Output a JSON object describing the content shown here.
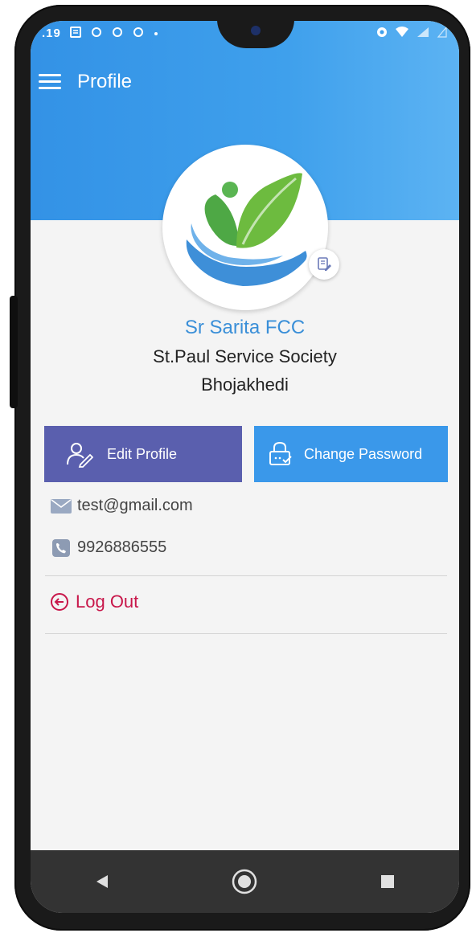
{
  "status_bar": {
    "time": ".19",
    "left_icons": [
      "notification-icon",
      "sync-icon",
      "sync-icon",
      "sync-icon",
      "dot-icon"
    ],
    "right_icons": [
      "alarm-icon",
      "wifi-icon",
      "signal-icon",
      "battery-icon"
    ]
  },
  "app_bar": {
    "title": "Profile",
    "menu_icon": "hamburger-menu-icon"
  },
  "profile": {
    "name": "Sr Sarita FCC",
    "organization": "St.Paul Service Society",
    "location": "Bhojakhedi",
    "avatar_icon": "leaf-hand-logo",
    "avatar_edit_icon": "edit-icon"
  },
  "actions": {
    "edit_profile_label": "Edit Profile",
    "change_password_label": "Change Password"
  },
  "contact": {
    "email": "test@gmail.com",
    "phone": "9926886555"
  },
  "logout": {
    "label": "Log Out"
  },
  "colors": {
    "header_blue": "#3392e6",
    "edit_button": "#5a5fae",
    "password_button": "#3a98ea",
    "name_color": "#3a8fd8",
    "logout_color": "#c8174a",
    "navbar": "#333333"
  },
  "nav_bar": {
    "back_icon": "back-triangle-icon",
    "home_icon": "home-circle-icon",
    "recents_icon": "recents-square-icon"
  }
}
